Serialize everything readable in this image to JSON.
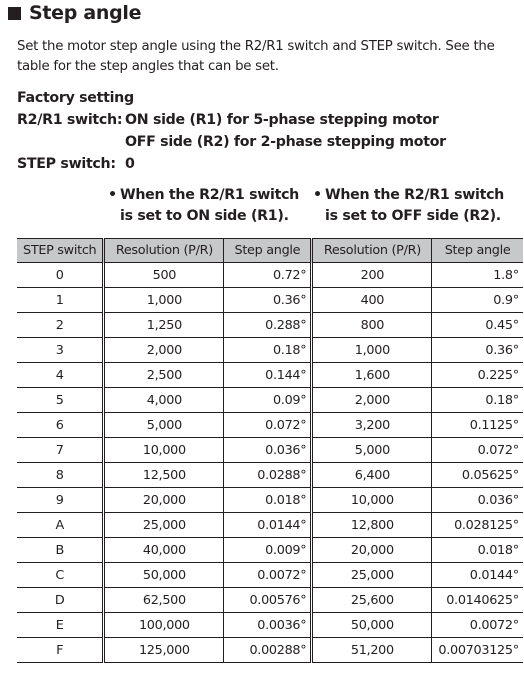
{
  "section": {
    "title": "Step angle",
    "intro": "Set the motor step angle using the R2/R1 switch and STEP switch. See the table for the step angles that can be set."
  },
  "factory_setting": {
    "heading": "Factory setting",
    "r2r1_label": "R2/R1 switch:",
    "r2r1_value_1": "ON side (R1) for 5-phase stepping motor",
    "r2r1_value_2": "OFF side (R2) for 2-phase stepping motor",
    "step_label": "STEP switch:",
    "step_value": "0"
  },
  "notes": [
    {
      "line1": "When the R2/R1 switch",
      "line2": "is set to ON side (R1)."
    },
    {
      "line1": "When the R2/R1 switch",
      "line2": "is set to OFF side (R2)."
    }
  ],
  "table": {
    "headers": [
      "STEP switch",
      "Resolution (P/R)",
      "Step angle",
      "Resolution (P/R)",
      "Step angle"
    ],
    "rows": [
      [
        "0",
        "500",
        "0.72°",
        "200",
        "1.8°"
      ],
      [
        "1",
        "1,000",
        "0.36°",
        "400",
        "0.9°"
      ],
      [
        "2",
        "1,250",
        "0.288°",
        "800",
        "0.45°"
      ],
      [
        "3",
        "2,000",
        "0.18°",
        "1,000",
        "0.36°"
      ],
      [
        "4",
        "2,500",
        "0.144°",
        "1,600",
        "0.225°"
      ],
      [
        "5",
        "4,000",
        "0.09°",
        "2,000",
        "0.18°"
      ],
      [
        "6",
        "5,000",
        "0.072°",
        "3,200",
        "0.1125°"
      ],
      [
        "7",
        "10,000",
        "0.036°",
        "5,000",
        "0.072°"
      ],
      [
        "8",
        "12,500",
        "0.0288°",
        "6,400",
        "0.05625°"
      ],
      [
        "9",
        "20,000",
        "0.018°",
        "10,000",
        "0.036°"
      ],
      [
        "A",
        "25,000",
        "0.0144°",
        "12,800",
        "0.028125°"
      ],
      [
        "B",
        "40,000",
        "0.009°",
        "20,000",
        "0.018°"
      ],
      [
        "C",
        "50,000",
        "0.0072°",
        "25,000",
        "0.0144°"
      ],
      [
        "D",
        "62,500",
        "0.00576°",
        "25,600",
        "0.0140625°"
      ],
      [
        "E",
        "100,000",
        "0.0036°",
        "50,000",
        "0.0072°"
      ],
      [
        "F",
        "125,000",
        "0.00288°",
        "51,200",
        "0.00703125°"
      ]
    ]
  },
  "colors": {
    "header_bg": "#c7c8ca",
    "text": "#231f20"
  }
}
